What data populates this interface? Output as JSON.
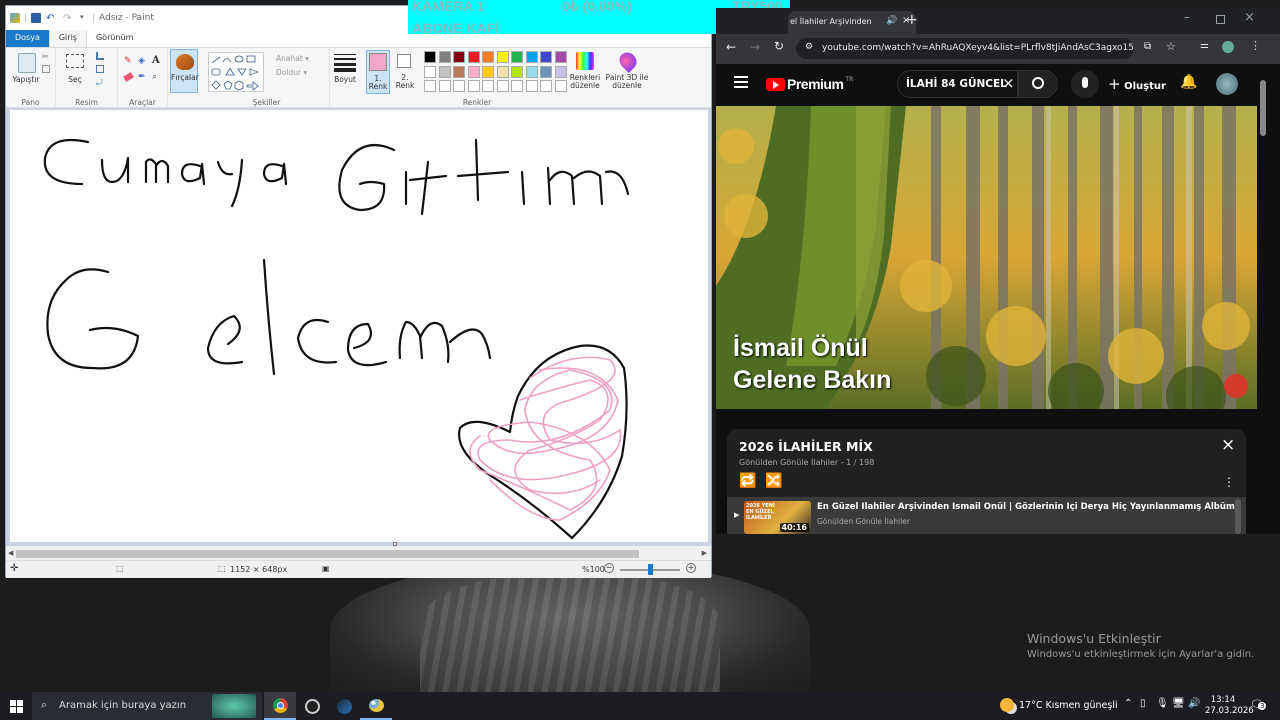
{
  "paint": {
    "title": "Adsız - Paint",
    "tabs": [
      "Dosya",
      "Giriş",
      "Görünüm"
    ],
    "groups": [
      "Pano",
      "Resim",
      "Araçlar",
      "Şekiller",
      "Renkler"
    ],
    "buttons": {
      "paste": "Yapıştır",
      "select": "Seç",
      "brushes": "Fırçalar",
      "outline": "Anahat",
      "fill": "Doldur",
      "size": "Boyut",
      "color1": "1. Renk",
      "color2": "2. Renk",
      "edit_colors": "Renkleri düzenle",
      "paint3d": "Paint 3D ile düzenle"
    },
    "palette": [
      "#000000",
      "#7f7f7f",
      "#880015",
      "#ed1c24",
      "#ff7f27",
      "#fff200",
      "#22b14c",
      "#00a2e8",
      "#3f48cc",
      "#a349a4",
      "#ffffff",
      "#c3c3c3",
      "#b97a57",
      "#ffaec9",
      "#ffc90e",
      "#efe4b0",
      "#b5e61d",
      "#99d9ea",
      "#7092be",
      "#c8bfe7"
    ],
    "color1": "#f4a6c8",
    "color2": "#ffffff",
    "canvas_text_line1": "Cumaya Gittim",
    "canvas_text_line2": "Gelcem",
    "status": {
      "dimensions": "1152 × 648px",
      "zoom": "%100"
    }
  },
  "overlay": {
    "line1_left": "KAMERA 1",
    "line1_mid": "0₺ (0.00%)",
    "line1_right": "TRY500",
    "line2": "ABONE KAFİ",
    "background": "#00ffff"
  },
  "chrome": {
    "tab_title": "el İlahiler Arşivinden",
    "url": "youtube.com/watch?v=AhRuAQXeyv4&list=PLrflv8tJiAndAsC3agxo15YPf..."
  },
  "youtube": {
    "brand": "Premium",
    "brand_sup": "TR",
    "search_query": "İLAHİ 84 GÜNCEL",
    "create_label": "Oluştur",
    "video_title_line1": "İsmail Önül",
    "video_title_line2": "Gelene Bakın",
    "playlist": {
      "title": "2026 İLAHİLER MİX",
      "subtitle": "Gönülden Gönüle İlahiler - 1 / 198",
      "item_title": "En Güzel İlahiler Arşivinden İsmail Önül | Gözlerinin İçi Derya Hiç Yayınlanmamış Albüm",
      "item_channel": "Gönülden Gönüle İlahiler",
      "item_duration": "40:16",
      "thumb_text": "2026 YENİ EN GÜZEL İLAHİLER"
    }
  },
  "desktop": {
    "watermark_title": "Windows'u Etkinleştir",
    "watermark_sub": "Windows'u etkinleştirmek için Ayarlar'a gidin."
  },
  "taskbar": {
    "search_placeholder": "Aramak için buraya yazın",
    "weather": "17°C  Kısmen güneşli",
    "time": "13:14",
    "date": "27.03.2026",
    "notifications": "3"
  }
}
